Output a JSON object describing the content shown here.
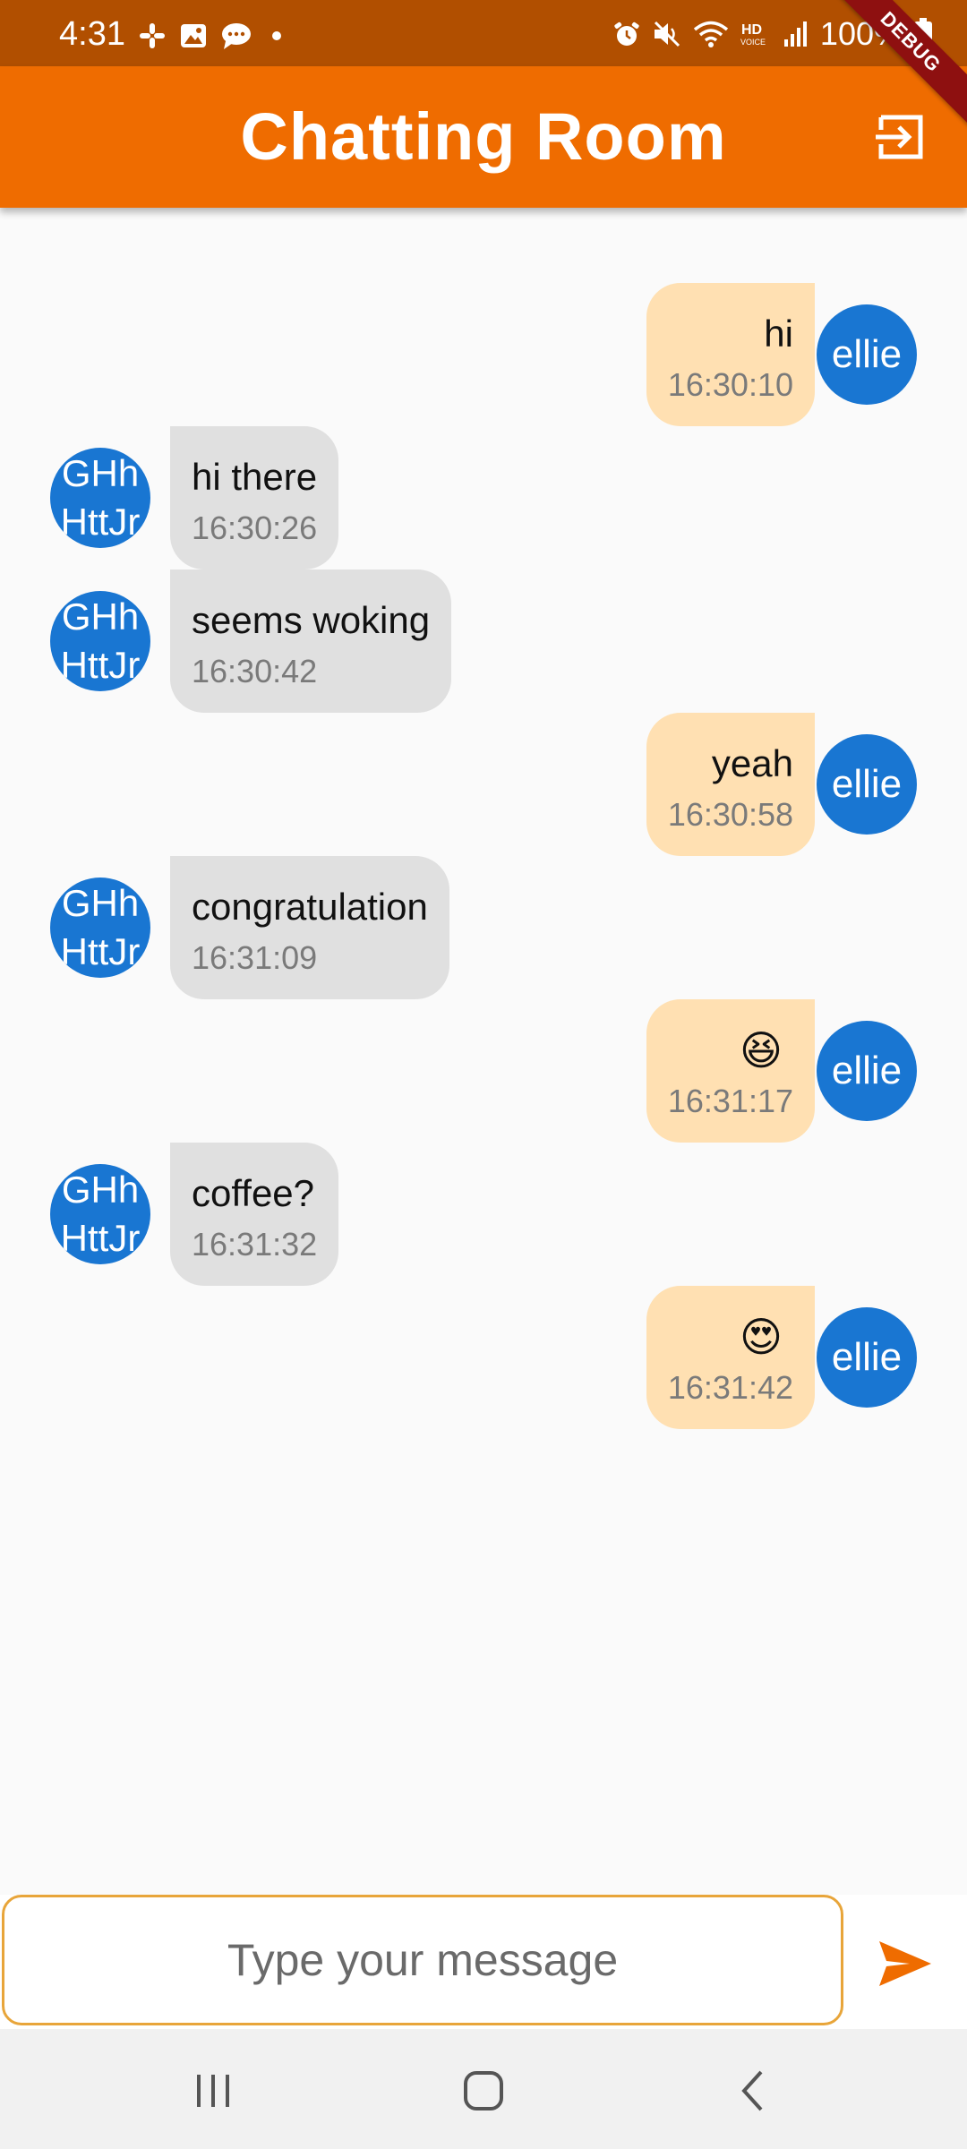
{
  "status_bar": {
    "time": "4:31",
    "battery": "100%",
    "left_icons": [
      "slack-icon",
      "gallery-icon",
      "chat-icon",
      "notification-dot-icon"
    ],
    "right_icons": [
      "alarm-icon",
      "mute-icon",
      "wifi-icon",
      "hd-voice-icon",
      "signal-icon",
      "battery-icon"
    ]
  },
  "debug_banner": "DEBUG",
  "app_bar": {
    "title": "Chatting Room",
    "action_icon": "logout-icon"
  },
  "messages": [
    {
      "sender": "me",
      "avatar": "ellie",
      "text": "hi",
      "time": "16:30:10",
      "is_emoji": false
    },
    {
      "sender": "other",
      "avatar": "GHh\nHttJr",
      "text": "hi there",
      "time": "16:30:26",
      "is_emoji": false
    },
    {
      "sender": "other",
      "avatar": "GHh\nHttJr",
      "text": "seems woking",
      "time": "16:30:42",
      "is_emoji": false
    },
    {
      "sender": "me",
      "avatar": "ellie",
      "text": "yeah",
      "time": "16:30:58",
      "is_emoji": false
    },
    {
      "sender": "other",
      "avatar": "GHh\nHttJr",
      "text": "congratulation",
      "time": "16:31:09",
      "is_emoji": false
    },
    {
      "sender": "me",
      "avatar": "ellie",
      "text": "😆",
      "time": "16:31:17",
      "is_emoji": true
    },
    {
      "sender": "other",
      "avatar": "GHh\nHttJr",
      "text": "coffee?",
      "time": "16:31:32",
      "is_emoji": false
    },
    {
      "sender": "me",
      "avatar": "ellie",
      "text": "😍",
      "time": "16:31:42",
      "is_emoji": true
    }
  ],
  "input": {
    "placeholder": "Type your message",
    "value": "",
    "send_icon": "send-icon"
  },
  "nav_bar": {
    "buttons": [
      "recent-apps-icon",
      "home-icon",
      "back-icon"
    ]
  },
  "colors": {
    "status_bar": "#b14f00",
    "app_bar": "#ef6c00",
    "my_bubble": "#ffe0b2",
    "other_bubble": "#e0e0e0",
    "avatar": "#1976d2",
    "input_border": "#e8a53a",
    "send": "#ef6c00"
  }
}
